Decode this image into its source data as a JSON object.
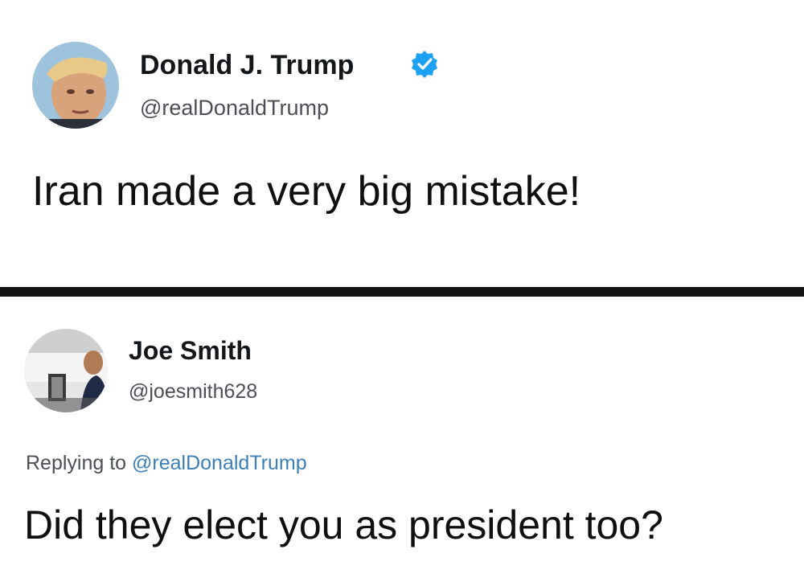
{
  "tweets": [
    {
      "display_name": "Donald J. Trump",
      "handle": "@realDonaldTrump",
      "verified": true,
      "text": "Iran made a very big mistake!"
    },
    {
      "display_name": "Joe Smith",
      "handle": "@joesmith628",
      "replying_prefix": "Replying to",
      "replying_to": "@realDonaldTrump",
      "text": "Did they elect you as president too?"
    }
  ],
  "colors": {
    "verified_badge": "#1da1f2",
    "mention_link": "#3b7fb6",
    "divider": "#141414"
  },
  "icons": {
    "verified": "verified-badge-icon"
  }
}
